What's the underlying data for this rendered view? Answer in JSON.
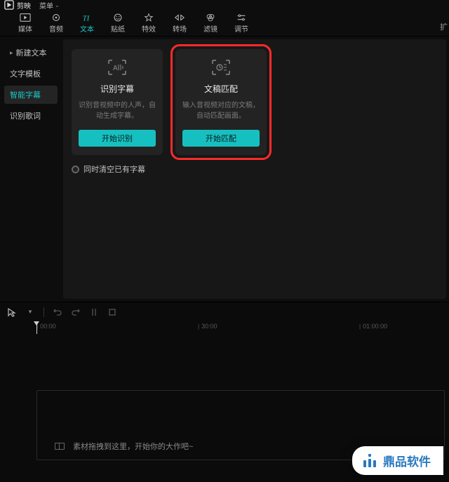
{
  "titlebar": {
    "app_name": "剪映",
    "menu_label": "菜单"
  },
  "toolbar": {
    "items": [
      {
        "label": "媒体"
      },
      {
        "label": "音频"
      },
      {
        "label": "文本"
      },
      {
        "label": "贴纸"
      },
      {
        "label": "特效"
      },
      {
        "label": "转场"
      },
      {
        "label": "滤镜"
      },
      {
        "label": "调节"
      }
    ],
    "ext_hint": "扩"
  },
  "sidebar": {
    "items": [
      {
        "label": "新建文本"
      },
      {
        "label": "文字模板"
      },
      {
        "label": "智能字幕"
      },
      {
        "label": "识别歌词"
      }
    ]
  },
  "cards": [
    {
      "title": "识别字幕",
      "desc": "识别音视频中的人声，自动生成字幕。",
      "button": "开始识别"
    },
    {
      "title": "文稿匹配",
      "desc": "输入音视频对应的文稿，自动匹配画面。",
      "button": "开始匹配"
    }
  ],
  "clear_label": "同时清空已有字幕",
  "ruler": {
    "t1": "00:00",
    "t2": "30:00",
    "t3": "01:00:00"
  },
  "track_hint": "素材拖拽到这里，开始你的大作吧~",
  "watermark": "鼎品软件"
}
